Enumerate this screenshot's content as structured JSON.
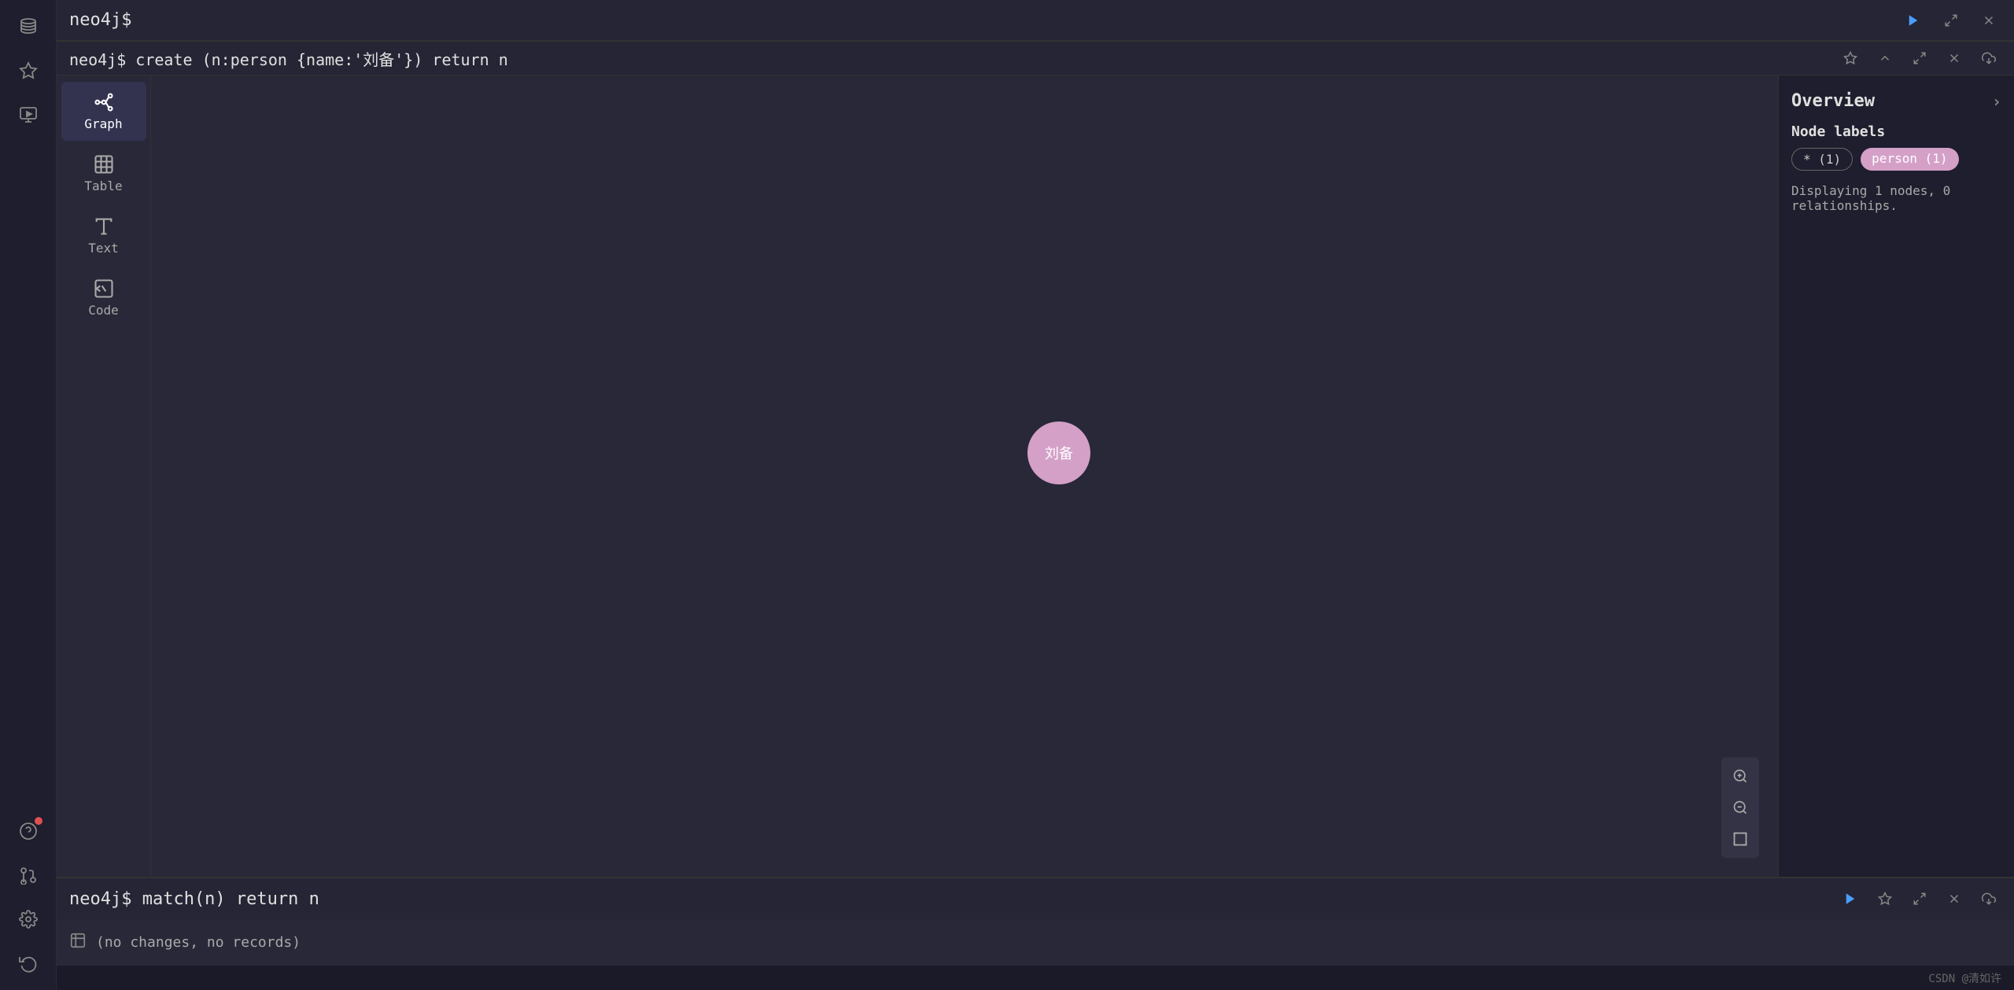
{
  "sidebar": {
    "icons": [
      {
        "name": "database-icon",
        "label": "Database"
      },
      {
        "name": "star-icon",
        "label": "Favorites"
      },
      {
        "name": "play-icon",
        "label": "Run"
      },
      {
        "name": "help-icon",
        "label": "Help",
        "has_dot": true
      },
      {
        "name": "connection-icon",
        "label": "Connection"
      },
      {
        "name": "settings-icon",
        "label": "Settings"
      },
      {
        "name": "undo-icon",
        "label": "Undo"
      }
    ]
  },
  "top_bar": {
    "query": "neo4j$",
    "actions": {
      "play_label": "▶",
      "expand_label": "⤢",
      "close_label": "✕"
    }
  },
  "first_panel": {
    "query": "neo4j$ create (n:person {name:'刘备'}) return n",
    "actions": {
      "pin_label": "📌",
      "up_label": "▲",
      "expand_label": "⤢",
      "close_label": "✕",
      "save_label": "💾"
    },
    "view_items": [
      {
        "id": "graph",
        "label": "Graph",
        "active": true
      },
      {
        "id": "table",
        "label": "Table",
        "active": false
      },
      {
        "id": "text",
        "label": "Text",
        "active": false
      },
      {
        "id": "code",
        "label": "Code",
        "active": false
      }
    ],
    "graph": {
      "node_label": "刘备",
      "node_color": "#d4a0c8"
    },
    "overview": {
      "title": "Overview",
      "node_labels_title": "Node labels",
      "badges": [
        {
          "text": "* (1)",
          "type": "all"
        },
        {
          "text": "person (1)",
          "type": "person"
        }
      ],
      "description": "Displaying 1 nodes, 0 relationships."
    },
    "zoom": {
      "zoom_in_label": "+",
      "zoom_out_label": "−",
      "fit_label": "⛶"
    }
  },
  "second_panel": {
    "query": "neo4j$ match(n) return n",
    "result_icon": "table-icon",
    "result_text": "(no changes, no records)"
  },
  "status_bar": {
    "text": "CSDN @清如许"
  }
}
